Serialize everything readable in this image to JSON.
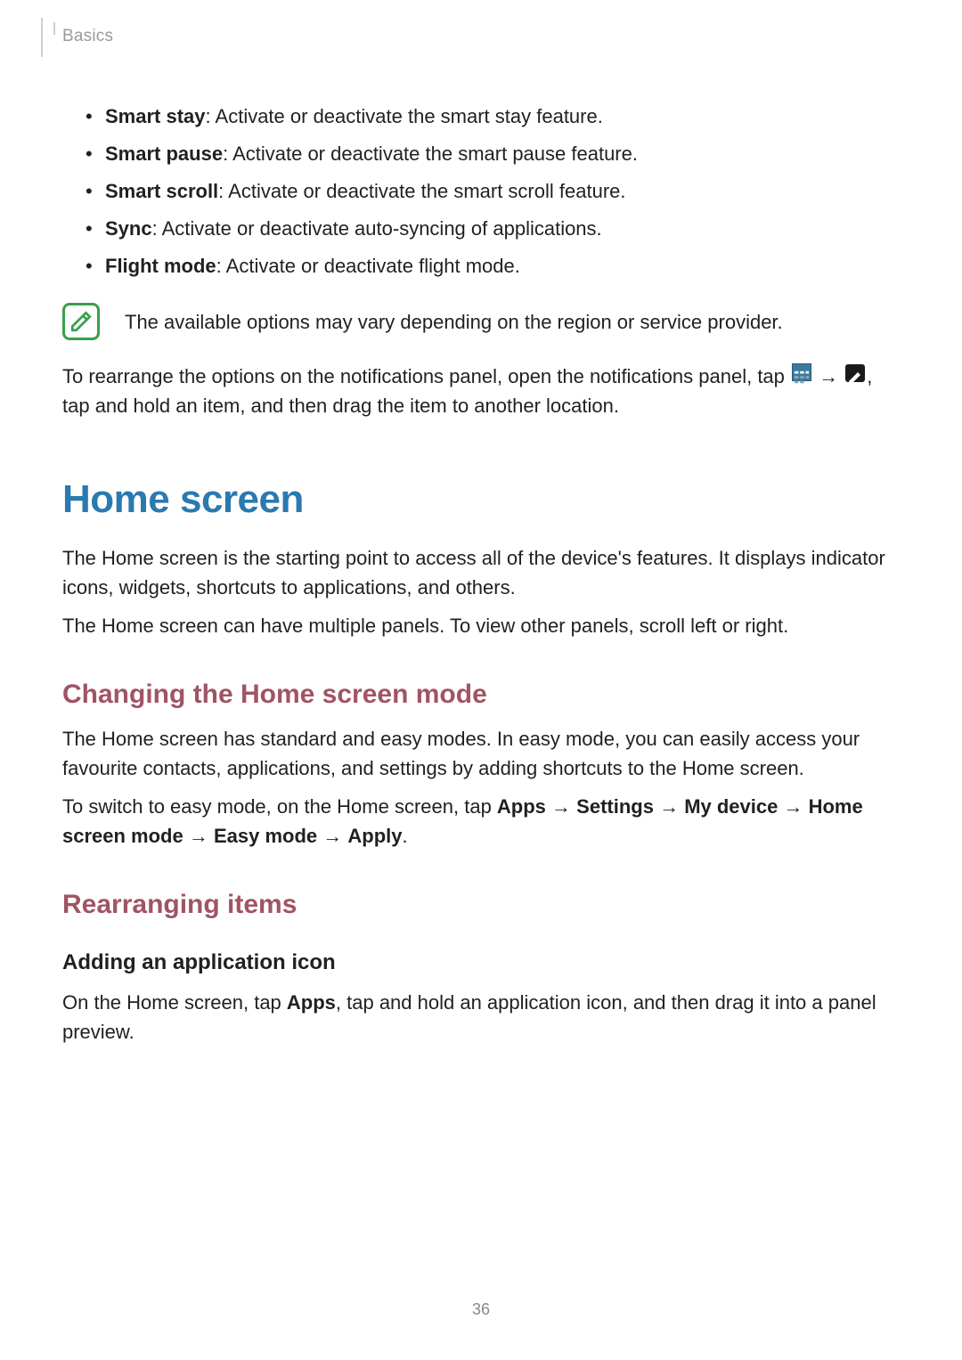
{
  "header": {
    "section": "Basics"
  },
  "bullets": [
    {
      "term": "Smart stay",
      "desc": ": Activate or deactivate the smart stay feature."
    },
    {
      "term": "Smart pause",
      "desc": ": Activate or deactivate the smart pause feature."
    },
    {
      "term": "Smart scroll",
      "desc": ": Activate or deactivate the smart scroll feature."
    },
    {
      "term": "Sync",
      "desc": ": Activate or deactivate auto-syncing of applications."
    },
    {
      "term": "Flight mode",
      "desc": ": Activate or deactivate flight mode."
    }
  ],
  "note": "The available options may vary depending on the region or service provider.",
  "rearrange": {
    "pre": "To rearrange the options on the notifications panel, open the notifications panel, tap ",
    "arrow": " → ",
    "post": ", tap and hold an item, and then drag the item to another location."
  },
  "h1": "Home screen",
  "intro1": "The Home screen is the starting point to access all of the device's features. It displays indicator icons, widgets, shortcuts to applications, and others.",
  "intro2": "The Home screen can have multiple panels. To view other panels, scroll left or right.",
  "h2a": "Changing the Home screen mode",
  "mode1": "The Home screen has standard and easy modes. In easy mode, you can easily access your favourite contacts, applications, and settings by adding shortcuts to the Home screen.",
  "mode2": {
    "pre": "To switch to easy mode, on the Home screen, tap ",
    "b1": "Apps",
    "a1": " → ",
    "b2": "Settings",
    "a2": " → ",
    "b3": "My device",
    "a3": " → ",
    "b4": "Home screen mode",
    "a4": " → ",
    "b5": "Easy mode",
    "a5": " → ",
    "b6": "Apply",
    "post": "."
  },
  "h2b": "Rearranging items",
  "h3a": "Adding an application icon",
  "add1": {
    "pre": "On the Home screen, tap ",
    "b1": "Apps",
    "post": ", tap and hold an application icon, and then drag it into a panel preview."
  },
  "pageNumber": "36"
}
